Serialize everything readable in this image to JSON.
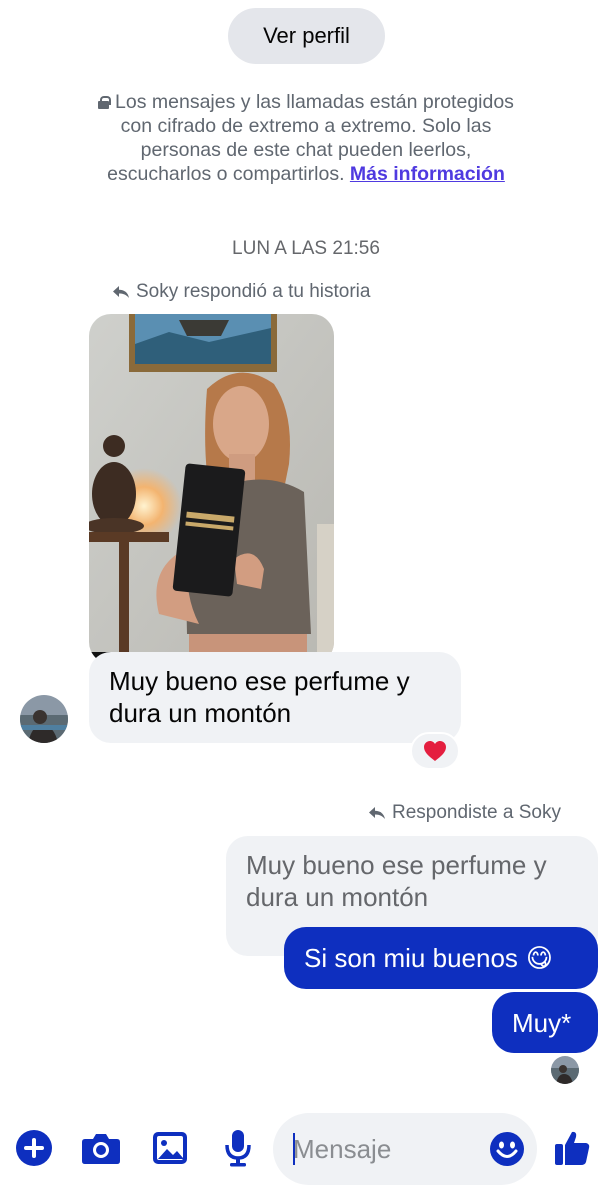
{
  "header": {
    "view_profile_label": "Ver perfil"
  },
  "encryption_notice": {
    "text": "Los mensajes y las llamadas están protegidos con cifrado de extremo a extremo. Solo las personas de este chat pueden leerlos, escucharlos o compartirlos.",
    "link_label": "Más información"
  },
  "timestamp": "LUN A LAS 21:56",
  "incoming": {
    "reply_context": "Soky respondió a tu historia",
    "message": "Muy bueno ese perfume y dura un montón",
    "reaction": "heart"
  },
  "outgoing": {
    "reply_context": "Respondiste a Soky",
    "quoted_message": "Muy bueno ese perfume y dura un montón",
    "messages": [
      {
        "text": "Si son miu buenos",
        "emoji": "😋"
      },
      {
        "text": "Muy*"
      }
    ]
  },
  "composer": {
    "placeholder": "Mensaje",
    "icons": [
      "plus-icon",
      "camera-icon",
      "gallery-icon",
      "microphone-icon",
      "emoji-icon",
      "thumbs-up-icon"
    ]
  },
  "colors": {
    "accent": "#0e2fbf",
    "link": "#4f3ae0",
    "bubble_gray": "#f0f2f5",
    "text_secondary": "#65676b"
  }
}
